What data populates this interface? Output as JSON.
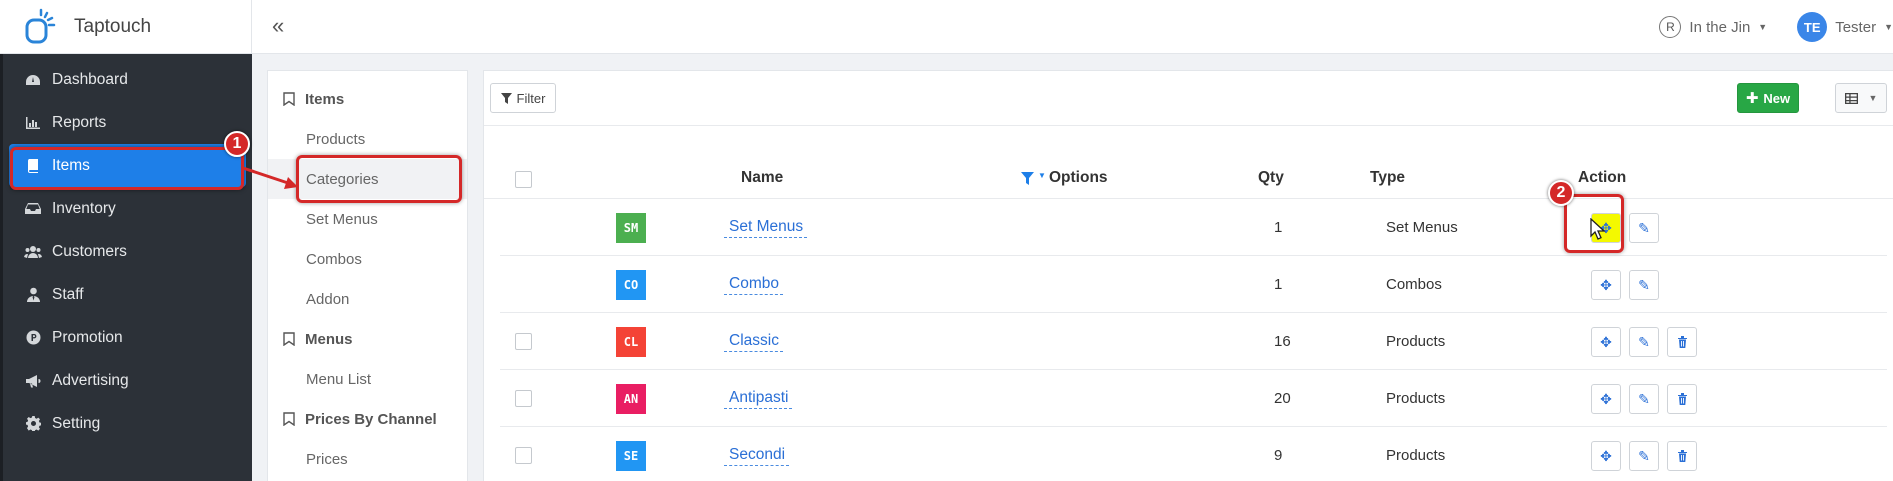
{
  "brand": {
    "name": "Taptouch"
  },
  "header": {
    "collapse_glyph": "«",
    "store_name": "In the Jin",
    "user_initials": "TE",
    "user_name": "Tester"
  },
  "sidebar": {
    "items": [
      {
        "label": "Dashboard",
        "icon": "dashboard-icon"
      },
      {
        "label": "Reports",
        "icon": "bar-chart-icon"
      },
      {
        "label": "Items",
        "icon": "book-icon",
        "active": true
      },
      {
        "label": "Inventory",
        "icon": "inbox-icon"
      },
      {
        "label": "Customers",
        "icon": "users-icon"
      },
      {
        "label": "Staff",
        "icon": "user-tie-icon"
      },
      {
        "label": "Promotion",
        "icon": "parking-icon"
      },
      {
        "label": "Advertising",
        "icon": "bullhorn-icon"
      },
      {
        "label": "Setting",
        "icon": "gear-icon"
      }
    ]
  },
  "submenu": {
    "sections": [
      {
        "title": "Items",
        "items": [
          "Products",
          "Categories",
          "Set Menus",
          "Combos",
          "Addon"
        ]
      },
      {
        "title": "Menus",
        "items": [
          "Menu List"
        ]
      },
      {
        "title": "Prices By Channel",
        "items": [
          "Prices"
        ]
      }
    ],
    "selected": "Categories"
  },
  "toolbar": {
    "filter_label": "Filter",
    "new_label": "New"
  },
  "table": {
    "columns": {
      "name": "Name",
      "options": "Options",
      "qty": "Qty",
      "type": "Type",
      "action": "Action"
    },
    "rows": [
      {
        "code": "SM",
        "color": "#4caf50",
        "name": "Set Menus",
        "qty": "1",
        "type": "Set Menus",
        "checkbox": false,
        "delete": false
      },
      {
        "code": "CO",
        "color": "#2196f3",
        "name": "Combo",
        "qty": "1",
        "type": "Combos",
        "checkbox": false,
        "delete": false
      },
      {
        "code": "CL",
        "color": "#f44336",
        "name": "Classic",
        "qty": "16",
        "type": "Products",
        "checkbox": true,
        "delete": true
      },
      {
        "code": "AN",
        "color": "#e91e63",
        "name": "Antipasti",
        "qty": "20",
        "type": "Products",
        "checkbox": true,
        "delete": true
      },
      {
        "code": "SE",
        "color": "#2196f3",
        "name": "Secondi",
        "qty": "9",
        "type": "Products",
        "checkbox": true,
        "delete": true
      }
    ]
  },
  "annotations": {
    "step1": "1",
    "step2": "2"
  },
  "colors": {
    "accent": "#1e7fe8",
    "highlight_red": "#d42828",
    "new_green": "#28a745"
  }
}
